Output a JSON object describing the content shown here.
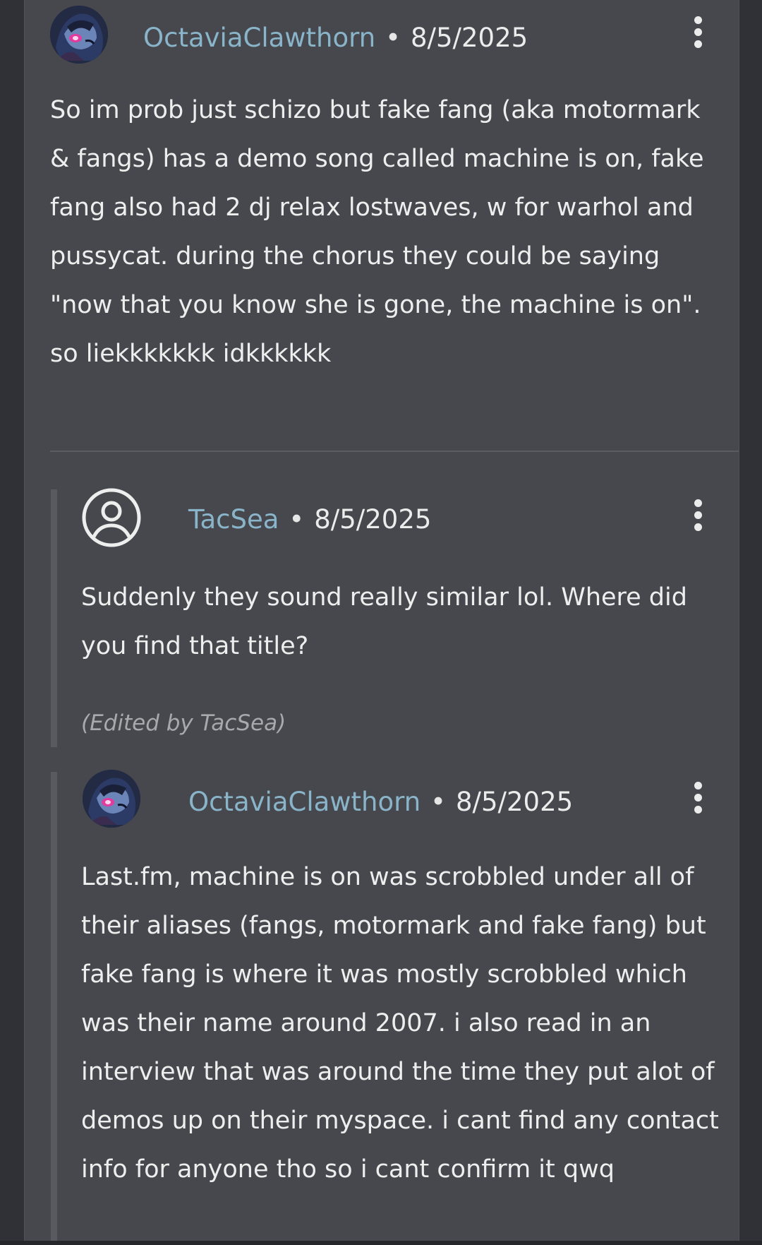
{
  "comments": [
    {
      "username": "OctaviaClawthorn",
      "separator": "•",
      "date": "8/5/2025",
      "avatar_icon": "anime-avatar-icon",
      "body": "So im prob just schizo but fake fang (aka motormark & fangs) has a demo song called machine is on, fake fang also had 2 dj relax lostwaves, w for warhol and pussycat. during the chorus they could be saying \"now that you know she is gone, the machine is on\". so liekkkkkkk idkkkkkk"
    },
    {
      "username": "TacSea",
      "separator": "•",
      "date": "8/5/2025",
      "avatar_icon": "default-user-icon",
      "body": "Suddenly they sound really similar lol. Where did you find that title?",
      "edited_note": "(Edited by TacSea)"
    },
    {
      "username": "OctaviaClawthorn",
      "separator": "•",
      "date": "8/5/2025",
      "avatar_icon": "anime-avatar-icon",
      "body": "Last.fm, machine is on was scrobbled under all of their aliases (fangs, motormark and fake fang) but fake fang is where it was mostly scrobbled which was their name around 2007. i also read in an interview that was around the time they put alot of demos up on their myspace. i cant find any contact info for anyone tho so i cant confirm it qwq"
    }
  ],
  "menu_icon": "more-vertical-icon",
  "colors": {
    "panel_bg": "#46484d",
    "page_bg": "#2f3136",
    "username": "#8ab4c9",
    "text": "#eeeeee",
    "muted": "#a8a9ac"
  }
}
